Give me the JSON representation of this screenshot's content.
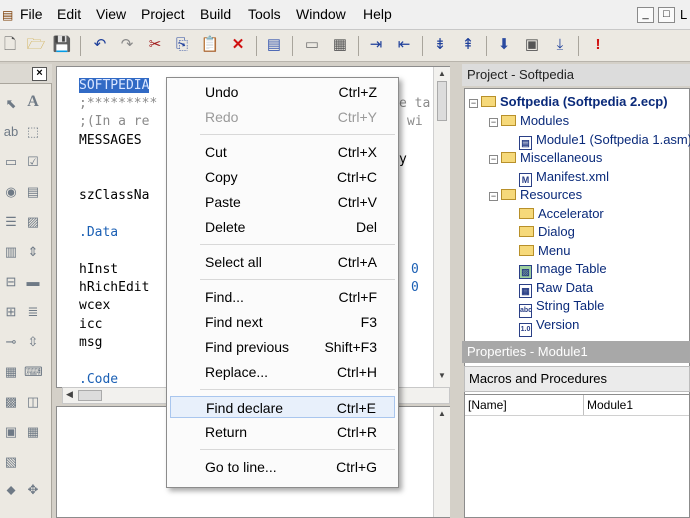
{
  "menubar": {
    "items": [
      "File",
      "Edit",
      "View",
      "Project",
      "Build",
      "Tools",
      "Window",
      "Help"
    ],
    "window_buttons": [
      "_",
      "□",
      "L"
    ]
  },
  "toolbar": {
    "icons": [
      "new-file-icon",
      "open-folder-icon",
      "save-icon",
      "undo-icon",
      "redo-icon",
      "cut-icon",
      "copy-icon",
      "paste-icon",
      "delete-icon",
      "document-icon",
      "window-icon",
      "properties-icon",
      "indent-icon",
      "outdent-icon",
      "bookmark-icon",
      "bookmark-next-icon",
      "build-icon",
      "run-icon",
      "stop-icon",
      "error-icon"
    ]
  },
  "toolpanel": {
    "close": "×",
    "tool_letter": "A"
  },
  "editor": {
    "lines": [
      {
        "text": "SOFTPEDIA",
        "color": "#0000c0",
        "selected": true
      },
      {
        "text": ";*********",
        "color": "#8a8a8a"
      },
      {
        "text": ";(In a re",
        "color": "#8a8a8a"
      },
      {
        "text": "MESSAGES",
        "color": "#000000"
      },
      {
        "text": "szClassNa",
        "color": "#000000"
      },
      {
        "text": ".Data",
        "color": "#1a5fb4"
      },
      {
        "text": "hInst",
        "color": "#000000"
      },
      {
        "text": "hRichEdit",
        "color": "#000000"
      },
      {
        "text": "wcex",
        "color": "#000000"
      },
      {
        "text": "icc",
        "color": "#000000"
      },
      {
        "text": "msg",
        "color": "#000000"
      },
      {
        "text": ".Code",
        "color": "#1a5fb4"
      }
    ],
    "right_fragments": [
      "e ta",
      "wi",
      "y",
      "0",
      "0"
    ]
  },
  "context_menu": {
    "items": [
      {
        "label": "Undo",
        "shortcut": "Ctrl+Z",
        "disabled": false
      },
      {
        "label": "Redo",
        "shortcut": "Ctrl+Y",
        "disabled": true
      },
      {
        "label": "Cut",
        "shortcut": "Ctrl+X",
        "disabled": false
      },
      {
        "label": "Copy",
        "shortcut": "Ctrl+C",
        "disabled": false
      },
      {
        "label": "Paste",
        "shortcut": "Ctrl+V",
        "disabled": false
      },
      {
        "label": "Delete",
        "shortcut": "Del",
        "disabled": false
      },
      {
        "label": "Select all",
        "shortcut": "Ctrl+A",
        "disabled": false
      },
      {
        "label": "Find...",
        "shortcut": "Ctrl+F",
        "disabled": false
      },
      {
        "label": "Find next",
        "shortcut": "F3",
        "disabled": false
      },
      {
        "label": "Find previous",
        "shortcut": "Shift+F3",
        "disabled": false
      },
      {
        "label": "Replace...",
        "shortcut": "Ctrl+H",
        "disabled": false
      },
      {
        "label": "Find declare",
        "shortcut": "Ctrl+E",
        "disabled": false,
        "highlighted": true
      },
      {
        "label": "Return",
        "shortcut": "Ctrl+R",
        "disabled": false
      },
      {
        "label": "Go to line...",
        "shortcut": "Ctrl+G",
        "disabled": false
      }
    ]
  },
  "project_panel": {
    "title": "Project - Softpedia",
    "tree": [
      {
        "label": "Softpedia (Softpedia 2.ecp)",
        "icon": "folder",
        "bold": true
      },
      {
        "label": "Modules",
        "icon": "folder"
      },
      {
        "label": "Module1 (Softpedia 1.asm)",
        "icon": "file"
      },
      {
        "label": "Miscellaneous",
        "icon": "folder"
      },
      {
        "label": "Manifest.xml",
        "icon": "manifest"
      },
      {
        "label": "Resources",
        "icon": "folder"
      },
      {
        "label": "Accelerator",
        "icon": "folder"
      },
      {
        "label": "Dialog",
        "icon": "folder"
      },
      {
        "label": "Menu",
        "icon": "folder"
      },
      {
        "label": "Image Table",
        "icon": "image"
      },
      {
        "label": "Raw Data",
        "icon": "raw"
      },
      {
        "label": "String Table",
        "icon": "abc"
      },
      {
        "label": "Version",
        "icon": "version"
      }
    ]
  },
  "properties_panel": {
    "title": "Properties - Module1",
    "dropdown": "Macros and Procedures",
    "row_name": "[Name]",
    "row_value": "Module1"
  }
}
